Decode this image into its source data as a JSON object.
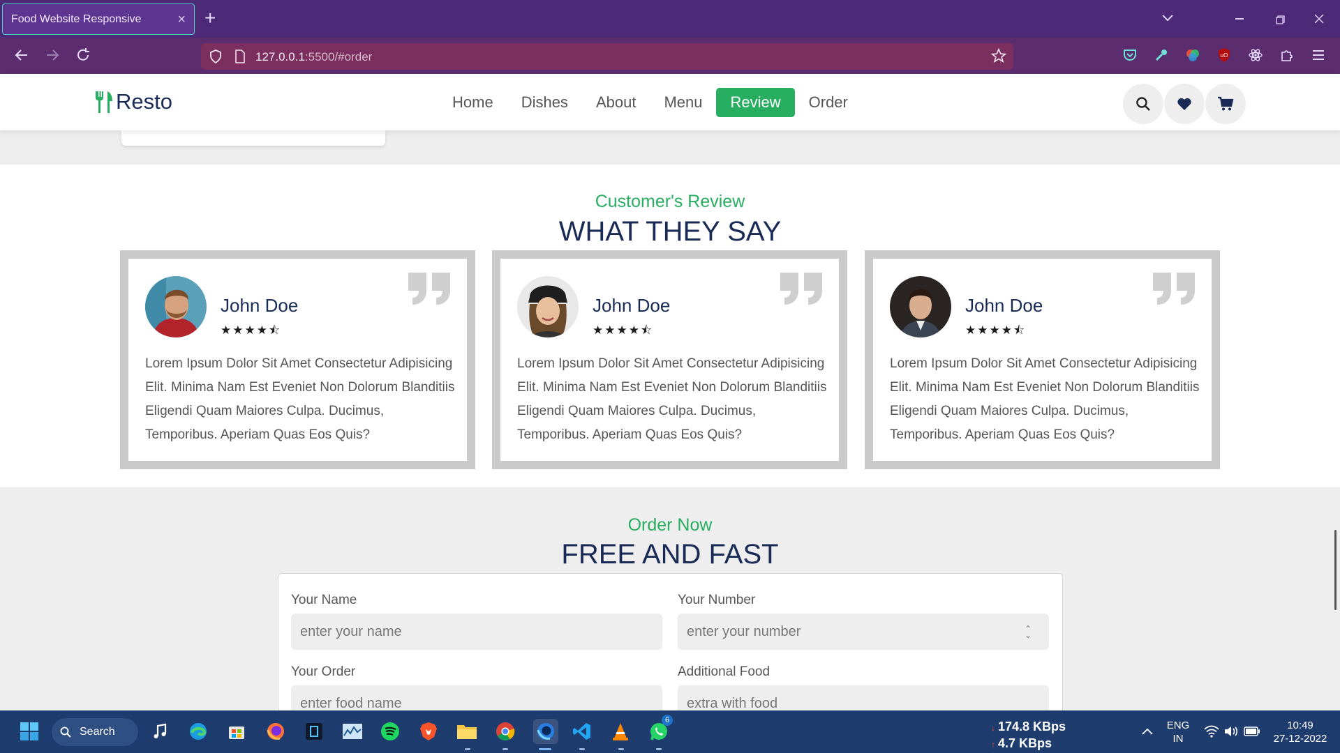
{
  "browser": {
    "tab_title": "Food Website Responsive",
    "tab_close": "×",
    "new_tab": "+",
    "url_host": "127.0.0.1",
    "url_rest": ":5500/#order"
  },
  "site": {
    "logo_text": "Resto",
    "nav": [
      "Home",
      "Dishes",
      "About",
      "Menu",
      "Review",
      "Order"
    ],
    "active_nav": "Review",
    "header_icons": [
      "search-icon",
      "heart-icon",
      "cart-icon"
    ]
  },
  "review": {
    "sub_heading": "Customer's Review",
    "heading": "what they say",
    "cards": [
      {
        "name": "John Doe",
        "rating": 4.5,
        "stars": "★★★★⯪",
        "text": "Lorem Ipsum Dolor Sit Amet Consectetur Adipisicing Elit. Minima Nam Est Eveniet Non Dolorum Blanditiis Eligendi Quam Maiores Culpa. Ducimus, Temporibus. Aperiam Quas Eos Quis?"
      },
      {
        "name": "John Doe",
        "rating": 4.5,
        "stars": "★★★★⯪",
        "text": "Lorem Ipsum Dolor Sit Amet Consectetur Adipisicing Elit. Minima Nam Est Eveniet Non Dolorum Blanditiis Eligendi Quam Maiores Culpa. Ducimus, Temporibus. Aperiam Quas Eos Quis?"
      },
      {
        "name": "John Doe",
        "rating": 4.5,
        "stars": "★★★★⯪",
        "text": "Lorem Ipsum Dolor Sit Amet Consectetur Adipisicing Elit. Minima Nam Est Eveniet Non Dolorum Blanditiis Eligendi Quam Maiores Culpa. Ducimus, Temporibus. Aperiam Quas Eos Quis?"
      }
    ]
  },
  "order": {
    "sub_heading": "Order Now",
    "heading": "free and fast",
    "fields": {
      "name": {
        "label": "Your Name",
        "placeholder": "enter your name"
      },
      "number": {
        "label": "Your Number",
        "placeholder": "enter your number"
      },
      "order": {
        "label": "Your Order",
        "placeholder": "enter food name"
      },
      "additional": {
        "label": "Additional Food",
        "placeholder": "extra with food"
      }
    }
  },
  "taskbar": {
    "search_label": "Search",
    "net_down": "174.8 KBps",
    "net_up": "4.7 KBps",
    "lang_line1": "ENG",
    "lang_line2": "IN",
    "time": "10:49",
    "date": "27-12-2022",
    "whatsapp_badge": "6"
  },
  "colors": {
    "accent": "#27ae60",
    "heading": "#192a56",
    "tabbar": "#4c2a78",
    "toolbar": "#5b2d6f",
    "taskbar": "#1f3c6e"
  }
}
